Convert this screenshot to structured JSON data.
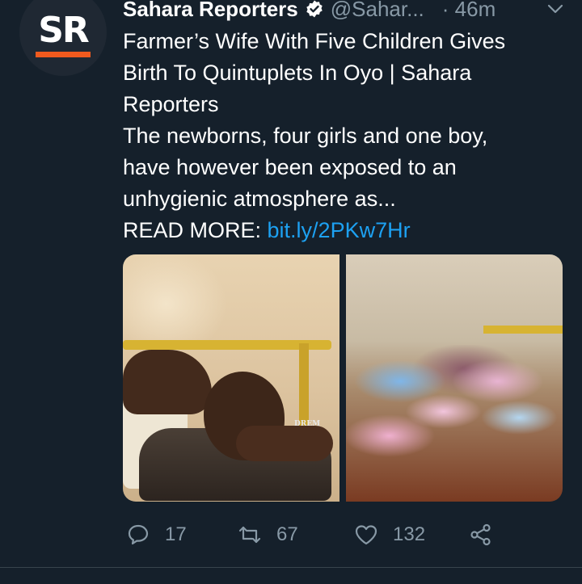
{
  "account": {
    "avatar_text": "SR",
    "name": "Sahara Reporters",
    "handle": "@Sahar...",
    "time": "· 46m",
    "accent_color": "#f05a1e"
  },
  "tweet": {
    "title_lines": [
      "Farmer’s Wife With Five Children Gives",
      "Birth To Quintuplets In Oyo | Sahara",
      "Reporters"
    ],
    "body_lines": [
      "The newborns, four girls and one boy,",
      "have however been exposed to an",
      "unhygienic atmosphere as..."
    ],
    "read_more_label": "READ MORE: ",
    "link_text": "bit.ly/2PKw7Hr",
    "link_color": "#1da1f2"
  },
  "media": {
    "left_image_icon": "photo-woman-lying-on-bed",
    "right_image_icon": "photo-baby-clothes-on-bed",
    "watermark": "DREM"
  },
  "actions": {
    "reply_icon": "reply-icon",
    "reply_count": "17",
    "retweet_icon": "retweet-icon",
    "retweet_count": "67",
    "like_icon": "heart-icon",
    "like_count": "132",
    "share_icon": "share-icon"
  },
  "colors": {
    "background": "#15202b",
    "muted_text": "#8899a6",
    "verified_badge": "#ffffff"
  }
}
